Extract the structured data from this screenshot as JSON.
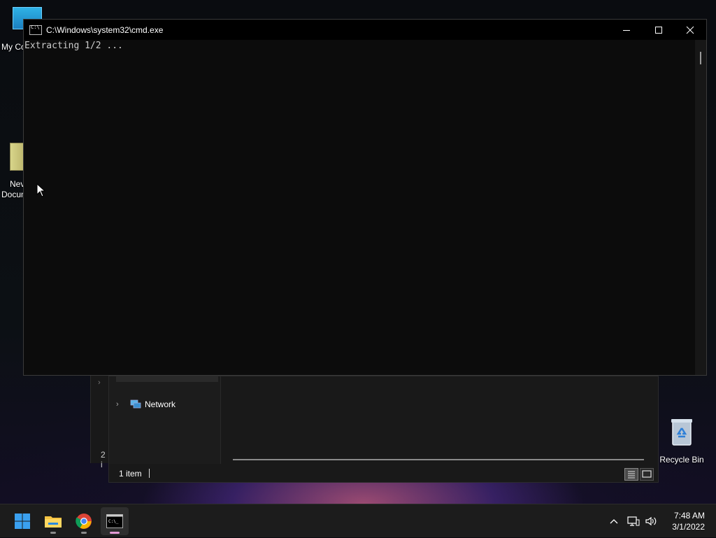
{
  "desktop": {
    "icons": [
      {
        "label": "My Co"
      },
      {
        "label_line1": "Nev",
        "label_line2": "Docum"
      },
      {
        "label": "Recycle Bin"
      }
    ]
  },
  "explorer": {
    "nav_items": [
      {
        "label": "Network",
        "icon": "network-icon"
      }
    ],
    "status": {
      "item_count": "1 item"
    },
    "behind_status": "2 i"
  },
  "cmd": {
    "title": "C:\\Windows\\system32\\cmd.exe",
    "output": "Extracting 1/2 ...",
    "buttons": {
      "minimize": "minimize",
      "maximize": "maximize",
      "close": "close"
    }
  },
  "taskbar": {
    "apps": [
      {
        "name": "start",
        "icon": "windows-start-icon"
      },
      {
        "name": "file-explorer",
        "icon": "folder-icon"
      },
      {
        "name": "chrome",
        "icon": "chrome-icon"
      },
      {
        "name": "command-prompt",
        "icon": "cmd-icon",
        "active": true
      }
    ],
    "clock": {
      "time": "7:48 AM",
      "date": "3/1/2022"
    }
  }
}
